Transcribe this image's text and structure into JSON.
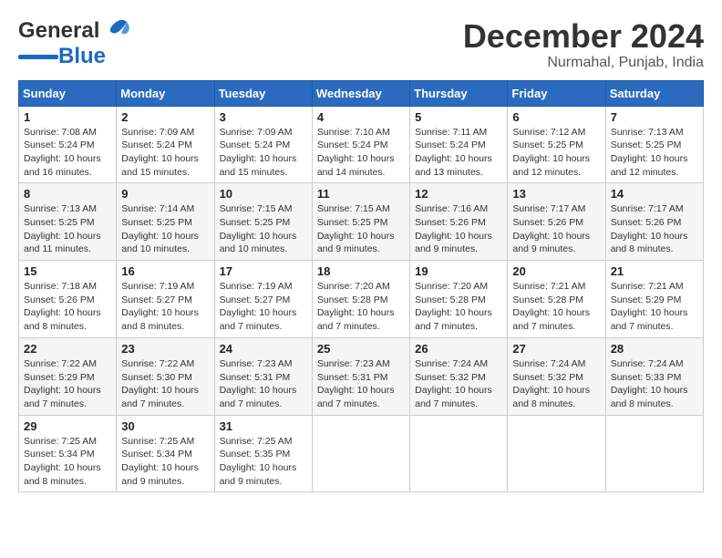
{
  "header": {
    "logo_general": "General",
    "logo_blue": "Blue",
    "month_title": "December 2024",
    "location": "Nurmahal, Punjab, India"
  },
  "weekdays": [
    "Sunday",
    "Monday",
    "Tuesday",
    "Wednesday",
    "Thursday",
    "Friday",
    "Saturday"
  ],
  "weeks": [
    [
      {
        "day": "1",
        "sunrise": "7:08 AM",
        "sunset": "5:24 PM",
        "daylight": "10 hours and 16 minutes."
      },
      {
        "day": "2",
        "sunrise": "7:09 AM",
        "sunset": "5:24 PM",
        "daylight": "10 hours and 15 minutes."
      },
      {
        "day": "3",
        "sunrise": "7:09 AM",
        "sunset": "5:24 PM",
        "daylight": "10 hours and 15 minutes."
      },
      {
        "day": "4",
        "sunrise": "7:10 AM",
        "sunset": "5:24 PM",
        "daylight": "10 hours and 14 minutes."
      },
      {
        "day": "5",
        "sunrise": "7:11 AM",
        "sunset": "5:24 PM",
        "daylight": "10 hours and 13 minutes."
      },
      {
        "day": "6",
        "sunrise": "7:12 AM",
        "sunset": "5:25 PM",
        "daylight": "10 hours and 12 minutes."
      },
      {
        "day": "7",
        "sunrise": "7:13 AM",
        "sunset": "5:25 PM",
        "daylight": "10 hours and 12 minutes."
      }
    ],
    [
      {
        "day": "8",
        "sunrise": "7:13 AM",
        "sunset": "5:25 PM",
        "daylight": "10 hours and 11 minutes."
      },
      {
        "day": "9",
        "sunrise": "7:14 AM",
        "sunset": "5:25 PM",
        "daylight": "10 hours and 10 minutes."
      },
      {
        "day": "10",
        "sunrise": "7:15 AM",
        "sunset": "5:25 PM",
        "daylight": "10 hours and 10 minutes."
      },
      {
        "day": "11",
        "sunrise": "7:15 AM",
        "sunset": "5:25 PM",
        "daylight": "10 hours and 9 minutes."
      },
      {
        "day": "12",
        "sunrise": "7:16 AM",
        "sunset": "5:26 PM",
        "daylight": "10 hours and 9 minutes."
      },
      {
        "day": "13",
        "sunrise": "7:17 AM",
        "sunset": "5:26 PM",
        "daylight": "10 hours and 9 minutes."
      },
      {
        "day": "14",
        "sunrise": "7:17 AM",
        "sunset": "5:26 PM",
        "daylight": "10 hours and 8 minutes."
      }
    ],
    [
      {
        "day": "15",
        "sunrise": "7:18 AM",
        "sunset": "5:26 PM",
        "daylight": "10 hours and 8 minutes."
      },
      {
        "day": "16",
        "sunrise": "7:19 AM",
        "sunset": "5:27 PM",
        "daylight": "10 hours and 8 minutes."
      },
      {
        "day": "17",
        "sunrise": "7:19 AM",
        "sunset": "5:27 PM",
        "daylight": "10 hours and 7 minutes."
      },
      {
        "day": "18",
        "sunrise": "7:20 AM",
        "sunset": "5:28 PM",
        "daylight": "10 hours and 7 minutes."
      },
      {
        "day": "19",
        "sunrise": "7:20 AM",
        "sunset": "5:28 PM",
        "daylight": "10 hours and 7 minutes."
      },
      {
        "day": "20",
        "sunrise": "7:21 AM",
        "sunset": "5:28 PM",
        "daylight": "10 hours and 7 minutes."
      },
      {
        "day": "21",
        "sunrise": "7:21 AM",
        "sunset": "5:29 PM",
        "daylight": "10 hours and 7 minutes."
      }
    ],
    [
      {
        "day": "22",
        "sunrise": "7:22 AM",
        "sunset": "5:29 PM",
        "daylight": "10 hours and 7 minutes."
      },
      {
        "day": "23",
        "sunrise": "7:22 AM",
        "sunset": "5:30 PM",
        "daylight": "10 hours and 7 minutes."
      },
      {
        "day": "24",
        "sunrise": "7:23 AM",
        "sunset": "5:31 PM",
        "daylight": "10 hours and 7 minutes."
      },
      {
        "day": "25",
        "sunrise": "7:23 AM",
        "sunset": "5:31 PM",
        "daylight": "10 hours and 7 minutes."
      },
      {
        "day": "26",
        "sunrise": "7:24 AM",
        "sunset": "5:32 PM",
        "daylight": "10 hours and 7 minutes."
      },
      {
        "day": "27",
        "sunrise": "7:24 AM",
        "sunset": "5:32 PM",
        "daylight": "10 hours and 8 minutes."
      },
      {
        "day": "28",
        "sunrise": "7:24 AM",
        "sunset": "5:33 PM",
        "daylight": "10 hours and 8 minutes."
      }
    ],
    [
      {
        "day": "29",
        "sunrise": "7:25 AM",
        "sunset": "5:34 PM",
        "daylight": "10 hours and 8 minutes."
      },
      {
        "day": "30",
        "sunrise": "7:25 AM",
        "sunset": "5:34 PM",
        "daylight": "10 hours and 9 minutes."
      },
      {
        "day": "31",
        "sunrise": "7:25 AM",
        "sunset": "5:35 PM",
        "daylight": "10 hours and 9 minutes."
      },
      null,
      null,
      null,
      null
    ]
  ],
  "labels": {
    "sunrise": "Sunrise:",
    "sunset": "Sunset:",
    "daylight": "Daylight:"
  }
}
